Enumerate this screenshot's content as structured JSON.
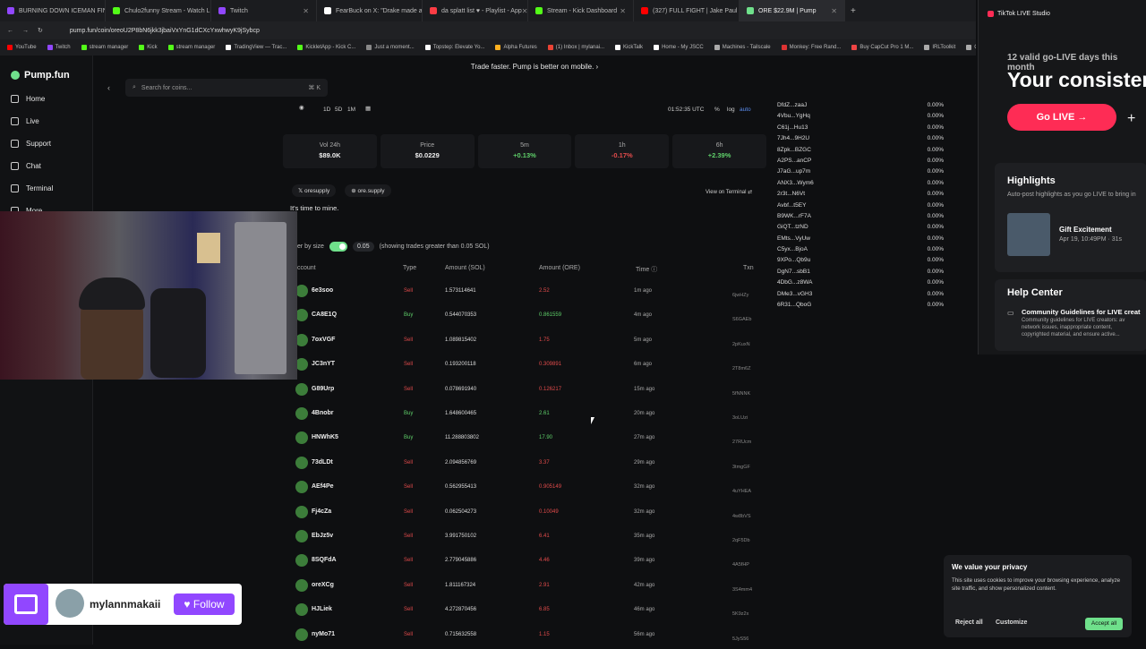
{
  "tabs": [
    {
      "label": "BURNING DOWN ICEMAN FIN",
      "color": "#9147ff"
    },
    {
      "label": "Chulo2funny Stream - Watch Li",
      "color": "#53fc18"
    },
    {
      "label": "Twitch",
      "color": "#9147ff"
    },
    {
      "label": "FearBuck on X: \"Drake made a",
      "color": "#ffffff"
    },
    {
      "label": "da splatt list ♥ - Playlist - App",
      "color": "#fc3c44"
    },
    {
      "label": "Stream - Kick Dashboard",
      "color": "#53fc18"
    },
    {
      "label": "(327) FULL FIGHT | Jake Paul vs",
      "color": "#ff0000"
    },
    {
      "label": "ORE $22.9M | Pump",
      "color": "#6fe08b"
    }
  ],
  "address": {
    "url": "pump.fun/coin/oreoU2P8bN6jkk3jbaiVxYnG1dCXcYxwhwyK9jSybcp"
  },
  "bookmarks": [
    "YouTube",
    "Twitch",
    "stream manager",
    "Kick",
    "stream manager",
    "TradingView — Trac...",
    "KickletApp - Kick C...",
    "Just a moment...",
    "Topstep: Elevate Yo...",
    "Alpha Futures",
    "(1) Inbox | mylanai...",
    "KickTalk",
    "Home - My JSCC",
    "Machines - Tailscale",
    "Monkey: Free Rand...",
    "Buy CapCut Pro 1 M...",
    "IRLToolkit",
    "Clothin"
  ],
  "sidebar": {
    "brand": "Pump.fun",
    "items": [
      "Home",
      "Live",
      "Support",
      "Chat",
      "Terminal",
      "More"
    ]
  },
  "banner": "Trade faster. Pump is better on mobile.  ›",
  "search": {
    "placeholder": "Search for coins...",
    "shortcut": "⌘ K"
  },
  "chart_toolbar": {
    "ranges": [
      "1D",
      "5D",
      "1M"
    ],
    "time": "01:52:35 UTC",
    "pct": "%",
    "log": "log",
    "auto": "auto"
  },
  "stats": [
    {
      "label": "Vol 24h",
      "value": "$89.0K",
      "color": "#eeeeee"
    },
    {
      "label": "Price",
      "value": "$0.0229",
      "color": "#eeeeee"
    },
    {
      "label": "5m",
      "value": "+0.13%",
      "color": "#5fd06a"
    },
    {
      "label": "1h",
      "value": "-0.17%",
      "color": "#e24b4b"
    },
    {
      "label": "6h",
      "value": "+2.39%",
      "color": "#5fd06a"
    }
  ],
  "links": {
    "x": "oresupply",
    "site": "ore.supply",
    "terminal": "View on Terminal ⇄"
  },
  "description": "It's time to mine.",
  "filter": {
    "label": "er by size",
    "amount": "0.05",
    "note": "(showing trades greater than 0.05 SOL)"
  },
  "table": {
    "headers": [
      "ccount",
      "Type",
      "Amount (SOL)",
      "Amount (ORE)",
      "Time ⓘ",
      "Txn"
    ],
    "rows": [
      {
        "account": "6e3soo",
        "type": "Sell",
        "sol": "1.573114641",
        "ore": "2.52",
        "time": "1m ago",
        "txn": "6jwHZy"
      },
      {
        "account": "CA8E1Q",
        "type": "Buy",
        "sol": "0.544070353",
        "ore": "0.861559",
        "time": "4m ago",
        "txn": "S6GAEb"
      },
      {
        "account": "7oxVGF",
        "type": "Sell",
        "sol": "1.089815402",
        "ore": "1.75",
        "time": "5m ago",
        "txn": "2pKuxN"
      },
      {
        "account": "JC3nYT",
        "type": "Sell",
        "sol": "0.193200118",
        "ore": "0.309891",
        "time": "6m ago",
        "txn": "2T8m6Z"
      },
      {
        "account": "G89Urp",
        "type": "Sell",
        "sol": "0.078691940",
        "ore": "0.126217",
        "time": "15m ago",
        "txn": "5fNNNK"
      },
      {
        "account": "4Bnobr",
        "type": "Buy",
        "sol": "1.648600465",
        "ore": "2.61",
        "time": "20m ago",
        "txn": "3oLUzi"
      },
      {
        "account": "HNWhK5",
        "type": "Buy",
        "sol": "11.288803802",
        "ore": "17.90",
        "time": "27m ago",
        "txn": "27RUcm"
      },
      {
        "account": "73dLDt",
        "type": "Sell",
        "sol": "2.094856769",
        "ore": "3.37",
        "time": "29m ago",
        "txn": "3tmgGF"
      },
      {
        "account": "AEf4Pe",
        "type": "Sell",
        "sol": "0.562955413",
        "ore": "0.905149",
        "time": "32m ago",
        "txn": "4uYHEA"
      },
      {
        "account": "Fj4cZa",
        "type": "Sell",
        "sol": "0.062504273",
        "ore": "0.10049",
        "time": "32m ago",
        "txn": "4w8bVS"
      },
      {
        "account": "EbJz5v",
        "type": "Sell",
        "sol": "3.991750102",
        "ore": "6.41",
        "time": "35m ago",
        "txn": "2qF5Db"
      },
      {
        "account": "8SQFdA",
        "type": "Sell",
        "sol": "2.779045886",
        "ore": "4.46",
        "time": "39m ago",
        "txn": "4A5fHP"
      },
      {
        "account": "oreXCg",
        "type": "Sell",
        "sol": "1.811167324",
        "ore": "2.91",
        "time": "42m ago",
        "txn": "3S4mm4"
      },
      {
        "account": "HJLiek",
        "type": "Sell",
        "sol": "4.272870456",
        "ore": "6.85",
        "time": "46m ago",
        "txn": "5K9z2x"
      },
      {
        "account": "nyMo71",
        "type": "Sell",
        "sol": "0.715632558",
        "ore": "1.15",
        "time": "56m ago",
        "txn": "5JyS56"
      }
    ]
  },
  "holders": [
    {
      "addr": "DfdZ...zaaJ",
      "pct": "0.00%"
    },
    {
      "addr": "4Vbu...YgHq",
      "pct": "0.00%"
    },
    {
      "addr": "C61j...Hu13",
      "pct": "0.00%"
    },
    {
      "addr": "7Jh4...9H2U",
      "pct": "0.00%"
    },
    {
      "addr": "8Zpk...BZGC",
      "pct": "0.00%"
    },
    {
      "addr": "A2PS...anCP",
      "pct": "0.00%"
    },
    {
      "addr": "J7aG...up7m",
      "pct": "0.00%"
    },
    {
      "addr": "ANX3...Wym6",
      "pct": "0.00%"
    },
    {
      "addr": "2r3t...N6Vt",
      "pct": "0.00%"
    },
    {
      "addr": "Avbf...t5EY",
      "pct": "0.00%"
    },
    {
      "addr": "B9WK...rF7A",
      "pct": "0.00%"
    },
    {
      "addr": "GiQT...tzND",
      "pct": "0.00%"
    },
    {
      "addr": "EMts...VyUw",
      "pct": "0.00%"
    },
    {
      "addr": "C5yx...BjoA",
      "pct": "0.00%"
    },
    {
      "addr": "9XPo...Qb9u",
      "pct": "0.00%"
    },
    {
      "addr": "DgN7...sbB1",
      "pct": "0.00%"
    },
    {
      "addr": "4DbG...z8WA",
      "pct": "0.00%"
    },
    {
      "addr": "DMe3...vGH3",
      "pct": "0.00%"
    },
    {
      "addr": "6R31...QboG",
      "pct": "0.00%"
    }
  ],
  "tiktok": {
    "title": "TikTok LIVE Studio",
    "streak": "12 valid go-LIVE days this month",
    "headline": "Your consister",
    "go_live": "Go LIVE →",
    "highlights_title": "Highlights",
    "highlights_sub": "Auto-post highlights as you go LIVE to bring in",
    "gift_title": "Gift Excitement",
    "gift_date": "Apr 19, 10:49PM · 31s",
    "help_title": "Help Center",
    "help_item": "Community Guidelines for LIVE creat",
    "help_desc": "Community guidelines for LIVE creators: av network issues, inappropriate content, copyrighted material, and ensure active..."
  },
  "follow": {
    "username": "mylannmakaii",
    "button": "Follow"
  },
  "cookie": {
    "title": "We value your privacy",
    "text": "This site uses cookies to improve your browsing experience, analyze site traffic, and show personalized content.",
    "reject": "Reject all",
    "customize": "Customize",
    "accept": "Accept all"
  }
}
